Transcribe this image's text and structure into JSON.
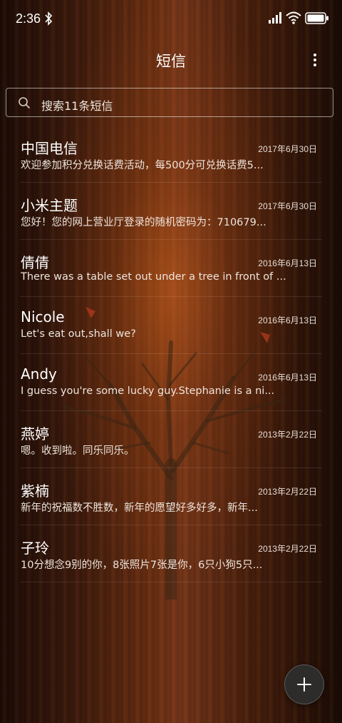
{
  "status_bar": {
    "time": "2:36",
    "icons": [
      "bluetooth-icon",
      "signal-icon",
      "wifi-icon",
      "battery-icon"
    ]
  },
  "header": {
    "title": "短信",
    "menu_icon": "more-vertical-icon"
  },
  "search": {
    "placeholder": "搜索11条短信",
    "icon": "search-icon"
  },
  "conversations": [
    {
      "name": "中国电信",
      "date": "2017年6月30日",
      "preview": "欢迎参加积分兑换话费活动，每500分可兑换话费5..."
    },
    {
      "name": "小米主题",
      "date": "2017年6月30日",
      "preview": "您好！您的网上营业厅登录的随机密码为：710679..."
    },
    {
      "name": "倩倩",
      "date": "2016年6月13日",
      "preview": "There was a table set out under a tree in front of ..."
    },
    {
      "name": "Nicole",
      "date": "2016年6月13日",
      "preview": "Let's eat out,shall we?"
    },
    {
      "name": "Andy",
      "date": "2016年6月13日",
      "preview": "I guess you're some lucky guy.Stephanie is a ni..."
    },
    {
      "name": "燕婷",
      "date": "2013年2月22日",
      "preview": "嗯。收到啦。同乐同乐。"
    },
    {
      "name": "紫楠",
      "date": "2013年2月22日",
      "preview": "新年的祝福数不胜数，新年的愿望好多好多，新年..."
    },
    {
      "name": "子玲",
      "date": "2013年2月22日",
      "preview": "10分想念9别的你，8张照片7张是你，6只小狗5只..."
    }
  ],
  "fab": {
    "icon": "plus-icon"
  },
  "colors": {
    "text": "#ffffff",
    "fab_background": "#2d2c2b",
    "wood_dark": "#1c0c06",
    "wood_glow": "#cd621c"
  }
}
